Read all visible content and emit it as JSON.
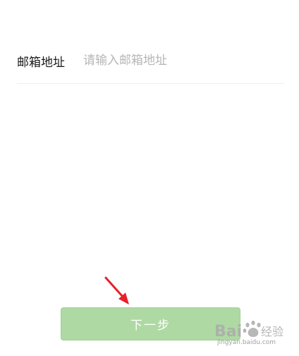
{
  "form": {
    "email_label": "邮箱地址",
    "email_value": "",
    "email_placeholder": "请输入邮箱地址"
  },
  "actions": {
    "next_label": "下一步"
  },
  "overlay": {
    "watermark_brand": "Bai 经验",
    "watermark_url": "jingyan.baidu.com"
  },
  "colors": {
    "button_bg": "#aed9a3",
    "button_text": "#ffffff",
    "label_text": "#1a1a1a",
    "placeholder_text": "#b6b6b6",
    "divider": "#efefef",
    "arrow": "#e8202a"
  },
  "icons": {
    "arrow": "red-arrow-icon",
    "watermark_logo": "baidu-paw-icon"
  }
}
